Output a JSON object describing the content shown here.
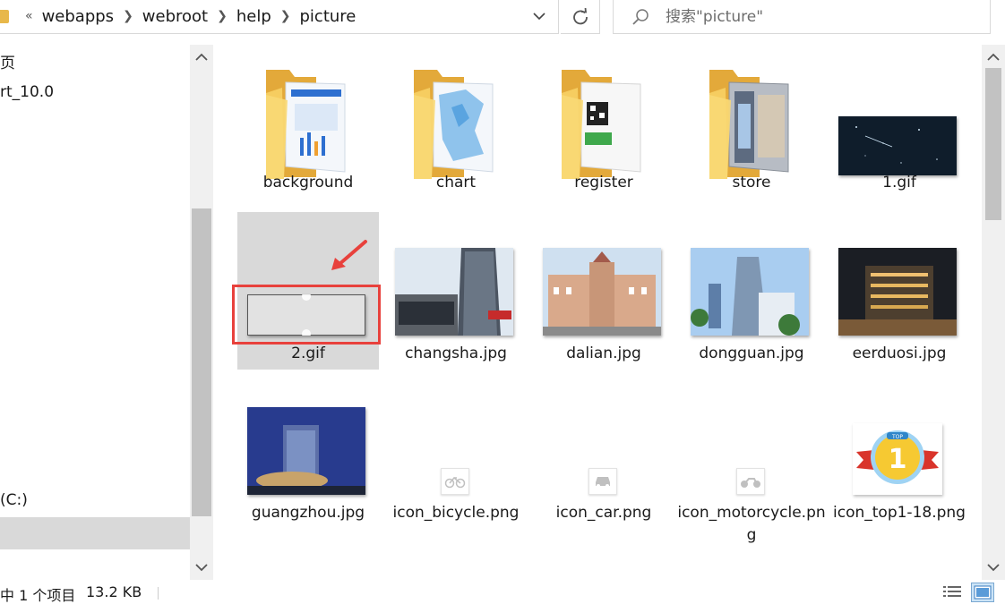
{
  "address": {
    "overflow_glyph": "«",
    "crumbs": [
      "webapps",
      "webroot",
      "help",
      "picture"
    ]
  },
  "search": {
    "placeholder": "搜索\"picture\""
  },
  "nav": {
    "items": [
      "页",
      "rt_10.0",
      "(C:)"
    ]
  },
  "files": [
    {
      "name": "background",
      "kind": "folder"
    },
    {
      "name": "chart",
      "kind": "folder"
    },
    {
      "name": "register",
      "kind": "folder"
    },
    {
      "name": "store",
      "kind": "folder"
    },
    {
      "name": "1.gif",
      "kind": "image"
    },
    {
      "name": "2.gif",
      "kind": "image",
      "selected": true
    },
    {
      "name": "changsha.jpg",
      "kind": "image"
    },
    {
      "name": "dalian.jpg",
      "kind": "image"
    },
    {
      "name": "dongguan.jpg",
      "kind": "image"
    },
    {
      "name": "eerduosi.jpg",
      "kind": "image"
    },
    {
      "name": "guangzhou.jpg",
      "kind": "image"
    },
    {
      "name": "icon_bicycle.png",
      "kind": "icon"
    },
    {
      "name": "icon_car.png",
      "kind": "icon"
    },
    {
      "name": "icon_motorcycle.png",
      "kind": "icon"
    },
    {
      "name": "icon_top1-18.png",
      "kind": "icon"
    }
  ],
  "status": {
    "selection": "中 1 个项目",
    "size": "13.2 KB"
  },
  "colors": {
    "annotation": "#e8413c",
    "selection": "#d9d9d9",
    "folder": "#f5c95b"
  },
  "icons": [
    "search-icon",
    "refresh-icon",
    "chevron-down-icon",
    "details-view-icon",
    "large-icons-view-icon"
  ]
}
